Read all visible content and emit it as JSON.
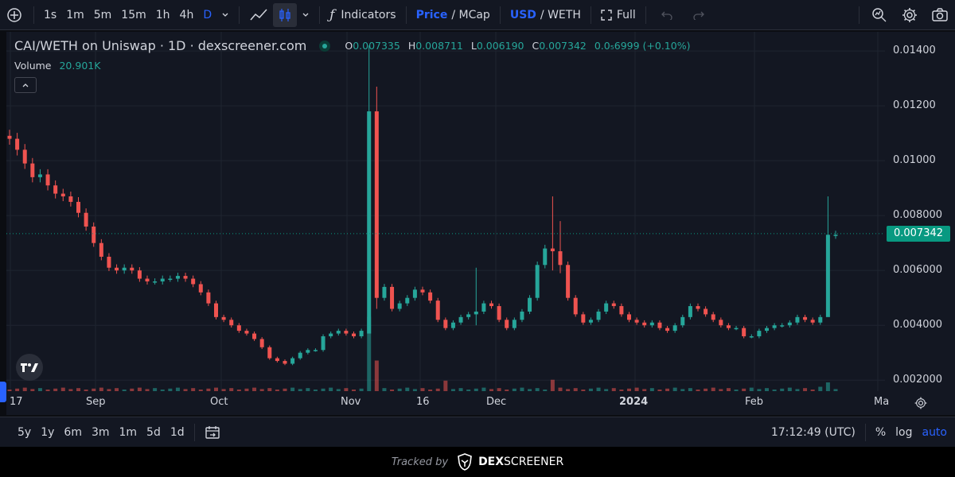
{
  "toolbar": {
    "intervals": [
      "1s",
      "1m",
      "5m",
      "15m",
      "1h",
      "4h",
      "D"
    ],
    "active_interval": "D",
    "indicators_label": "Indicators",
    "price_label": "Price",
    "mcap_label": "/ MCap",
    "usd_label": "USD",
    "weth_label": "/ WETH",
    "full_label": "Full"
  },
  "legend": {
    "symbol": "CAI/WETH on Uniswap · 1D · dexscreener.com",
    "o_label": "O",
    "o_value": "0.007335",
    "h_label": "H",
    "h_value": "0.008711",
    "l_label": "L",
    "l_value": "0.006190",
    "c_label": "C",
    "c_value": "0.007342",
    "change": "0.0₅6999 (+0.10%)",
    "volume_label": "Volume",
    "volume_value": "20.901K"
  },
  "colors": {
    "up": "#26a69a",
    "down": "#ef5350",
    "accent": "#2962ff",
    "current_price_bg": "#089981"
  },
  "chart_data": {
    "type": "candlestick",
    "y_axis_ticks": [
      "0.01400",
      "0.01200",
      "0.01000",
      "0.008000",
      "0.006000",
      "0.004000",
      "0.002000"
    ],
    "current_price": "0.007342",
    "x_axis_ticks": [
      "17",
      "Sep",
      "Oct",
      "Nov",
      "16",
      "Dec",
      "2024",
      "Feb",
      "Ma"
    ],
    "ylim": [
      0.0016,
      0.0147
    ],
    "series_points": [
      0.0108,
      0.0104,
      0.0099,
      0.0094,
      0.0095,
      0.0091,
      0.0088,
      0.0087,
      0.0085,
      0.0081,
      0.0076,
      0.007,
      0.0065,
      0.0061,
      0.006,
      0.0061,
      0.006,
      0.0057,
      0.0056,
      0.0056,
      0.0057,
      0.0057,
      0.0058,
      0.0057,
      0.0055,
      0.0052,
      0.0048,
      0.0043,
      0.0042,
      0.004,
      0.0038,
      0.0037,
      0.0035,
      0.0032,
      0.0028,
      0.0027,
      0.0026,
      0.0028,
      0.003,
      0.0031,
      0.0031,
      0.0036,
      0.0037,
      0.0038,
      0.0037,
      0.0036,
      0.0038,
      0.0118,
      0.005,
      0.0054,
      0.0046,
      0.0048,
      0.005,
      0.0053,
      0.0052,
      0.0049,
      0.0042,
      0.0039,
      0.0041,
      0.0043,
      0.0044,
      0.0045,
      0.0048,
      0.0047,
      0.0042,
      0.0039,
      0.0042,
      0.0045,
      0.005,
      0.0062,
      0.0068,
      0.0067,
      0.0062,
      0.005,
      0.0044,
      0.0041,
      0.0042,
      0.0045,
      0.0048,
      0.0047,
      0.0044,
      0.0042,
      0.0041,
      0.004,
      0.0041,
      0.0039,
      0.0038,
      0.004,
      0.0043,
      0.0047,
      0.0046,
      0.0044,
      0.0042,
      0.004,
      0.0039,
      0.0039,
      0.0036,
      0.0036,
      0.0038,
      0.0039,
      0.004,
      0.004,
      0.0041,
      0.0043,
      0.0042,
      0.0041,
      0.0043,
      0.0073,
      0.0073
    ],
    "wicks": [
      {
        "i": 47,
        "high": 0.0142,
        "low": 0.0049
      },
      {
        "i": 48,
        "high": 0.0127,
        "low": 0.0046
      },
      {
        "i": 61,
        "high": 0.0061,
        "low": 0.004
      },
      {
        "i": 71,
        "high": 0.0087,
        "low": 0.006
      },
      {
        "i": 72,
        "high": 0.0078,
        "low": 0.0059
      },
      {
        "i": 107,
        "high": 0.0087,
        "low": 0.0062
      }
    ],
    "volume_spikes": [
      {
        "i": 47,
        "v": 0.85
      },
      {
        "i": 48,
        "v": 0.35
      },
      {
        "i": 57,
        "v": 0.12
      },
      {
        "i": 71,
        "v": 0.13
      },
      {
        "i": 107,
        "v": 0.1
      },
      {
        "i": 106,
        "v": 0.05
      }
    ]
  },
  "bottom": {
    "ranges": [
      "5y",
      "1y",
      "6m",
      "3m",
      "1m",
      "5d",
      "1d"
    ],
    "time": "17:12:49 (UTC)",
    "percent_label": "%",
    "log_label": "log",
    "auto_label": "auto"
  },
  "footer": {
    "tracked_by": "Tracked by",
    "brand_dex": "DEX",
    "brand_screener": "SCREENER"
  }
}
